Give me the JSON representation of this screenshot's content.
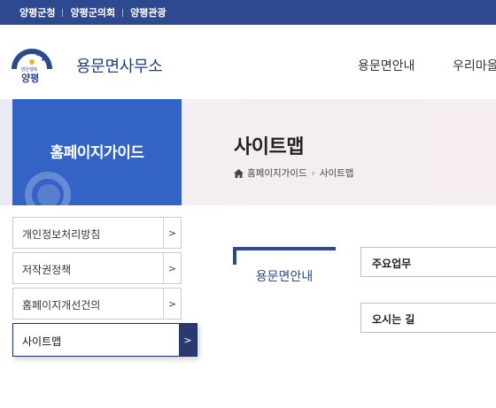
{
  "topbar": {
    "links": [
      "양평군청",
      "양평군의회",
      "양평관광"
    ]
  },
  "header": {
    "logo_text": "양평",
    "logo_slogan": "맑은행복",
    "site_title": "용문면사무소",
    "gnb": [
      "용문면안내",
      "우리마을"
    ]
  },
  "band": {
    "sidebar_title": "홈페이지가이드",
    "page_title": "사이트맵",
    "breadcrumb": [
      "홈페이지가이드",
      "사이트맵"
    ]
  },
  "side_menu": [
    {
      "label": "개인정보처리방침",
      "arrow": ">"
    },
    {
      "label": "저작권정책",
      "arrow": ">"
    },
    {
      "label": "홈페이지개선건의",
      "arrow": ">"
    },
    {
      "label": "사이트맵",
      "arrow": ">"
    }
  ],
  "content": {
    "section_title": "용문면안내",
    "items": [
      "주요업무",
      "오시는 길"
    ]
  },
  "colors": {
    "primary": "#2d4a91",
    "sidebar_blue": "#3363c4",
    "active_arrow": "#2b3a6e"
  }
}
